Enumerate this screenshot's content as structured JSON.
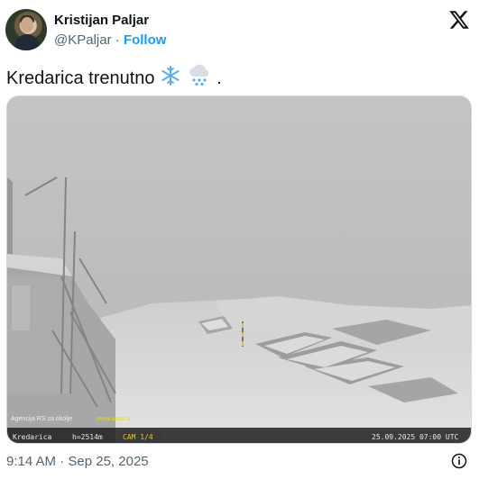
{
  "author": {
    "name": "Kristijan Paljar",
    "handle": "@KPaljar",
    "separator": "·",
    "follow_label": "Follow"
  },
  "tweet": {
    "text": "Kredarica trenutno",
    "trailing": ".",
    "emojis": [
      "snowflake-icon",
      "cloud-with-snow-icon"
    ]
  },
  "webcam": {
    "watermark_left": "Agencija RS za okolje",
    "watermark_site": "www.arso.si",
    "station": "Kredarica",
    "altitude": "h=2514m",
    "camera": "CAM 1/4",
    "timestamp": "25.09.2025 07:00 UTC"
  },
  "meta": {
    "time": "9:14 AM",
    "separator": "·",
    "date": "Sep 25, 2025"
  },
  "colors": {
    "accent": "#1d9bf0",
    "muted": "#536471",
    "fog": "#bdbdbd",
    "snow": "#e8e8e8"
  }
}
